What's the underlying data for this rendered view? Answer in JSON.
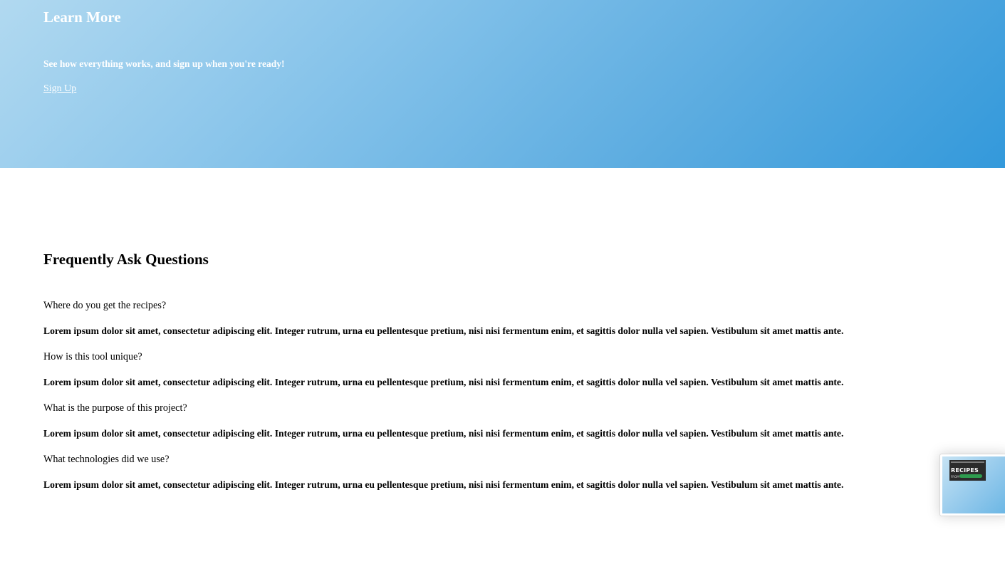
{
  "hero": {
    "title": "Learn More",
    "subtitle": "See how everything works, and sign up when you're ready!",
    "signup_label": "Sign Up"
  },
  "faq": {
    "title": "Frequently Ask Questions",
    "items": [
      {
        "question": "Where do you get the recipes?",
        "answer": "Lorem ipsum dolor sit amet, consectetur adipiscing elit. Integer rutrum, urna eu pellentesque pretium, nisi nisi fermentum enim, et sagittis dolor nulla vel sapien. Vestibulum sit amet mattis ante."
      },
      {
        "question": "How is this tool unique?",
        "answer": "Lorem ipsum dolor sit amet, consectetur adipiscing elit. Integer rutrum, urna eu pellentesque pretium, nisi nisi fermentum enim, et sagittis dolor nulla vel sapien. Vestibulum sit amet mattis ante."
      },
      {
        "question": "What is the purpose of this project?",
        "answer": "Lorem ipsum dolor sit amet, consectetur adipiscing elit. Integer rutrum, urna eu pellentesque pretium, nisi nisi fermentum enim, et sagittis dolor nulla vel sapien. Vestibulum sit amet mattis ante."
      },
      {
        "question": "What technologies did we use?",
        "answer": "Lorem ipsum dolor sit amet, consectetur adipiscing elit. Integer rutrum, urna eu pellentesque pretium, nisi nisi fermentum enim, et sagittis dolor nulla vel sapien. Vestibulum sit amet mattis ante."
      }
    ]
  },
  "thumbnail": {
    "title": "RECIPES",
    "from_label": "FROM"
  }
}
